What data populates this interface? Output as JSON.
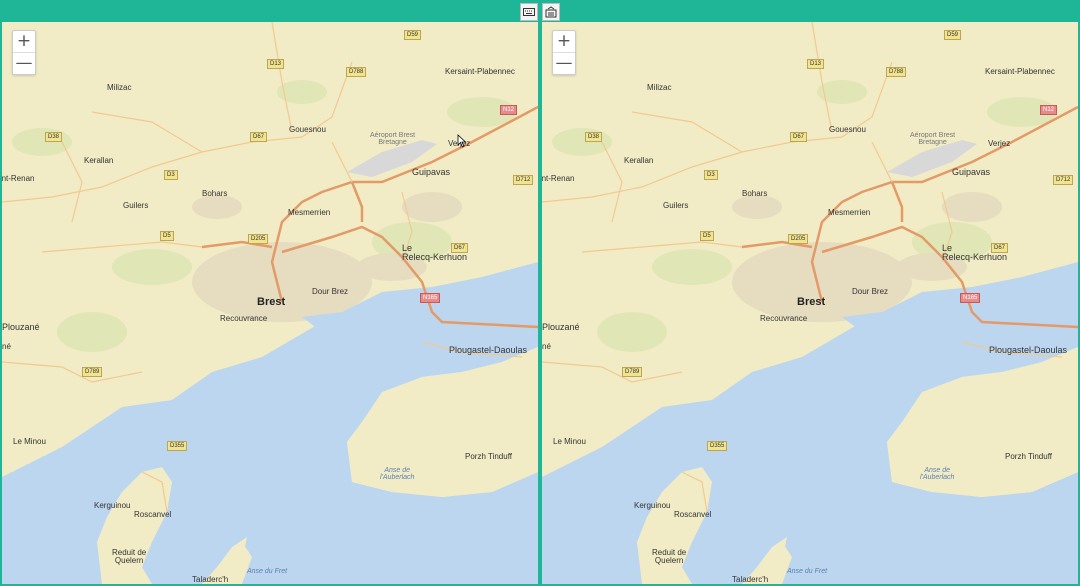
{
  "toolbar": {
    "buttons": [
      {
        "name": "keyboard-icon"
      },
      {
        "name": "sync-icon"
      }
    ]
  },
  "zoom": {
    "in_label": "+",
    "out_label": "—"
  },
  "colors": {
    "land": "#f1ecc6",
    "water": "#bcd6f0",
    "major_road": "#e39a67",
    "minor_road": "#f2c990",
    "frame": "#1fb597"
  },
  "map": {
    "places": {
      "milizac": "Milizac",
      "kersaint": "Kersaint-Plabennec",
      "airport": "Aéroport Brest\nBretagne",
      "gouesnou": "Gouesnou",
      "kerallan": "Kerallan",
      "verjez": "Verjez",
      "saint_renan": "Saint-Renan",
      "guipavas": "Guipavas",
      "bohars": "Bohars",
      "guilers": "Guilers",
      "mesmerrien": "Mesmerrien",
      "le_relecq": "Le\nRelecq-Kerhuon",
      "brest": "Brest",
      "dour_brez": "Dour Brez",
      "recouvrance": "Recouvrance",
      "plouzane": "Plouzané",
      "ne": "né",
      "plougastel": "Plougastel-Daoulas",
      "le_minou": "Le Minou",
      "porzh_tinduff": "Porzh Tinduff",
      "anse_kerhuon": "Anse de\nl'Auberlach",
      "kerguinou": "Kerguinou",
      "roscanvel": "Roscanvel",
      "reduit": "Reduit de\nQuelern",
      "taladerch": "Taladerc'h",
      "anse_fret": "Anse du Fret"
    },
    "shields": {
      "d59": "D59",
      "d13": "D13",
      "d788": "D788",
      "n12": "N12",
      "d38": "D38",
      "d67a": "D67",
      "d712": "D712",
      "d3": "D3",
      "d5": "D5",
      "d205": "D205",
      "d67b": "D67",
      "n165": "N165",
      "d789": "D789",
      "d355": "D355"
    }
  }
}
